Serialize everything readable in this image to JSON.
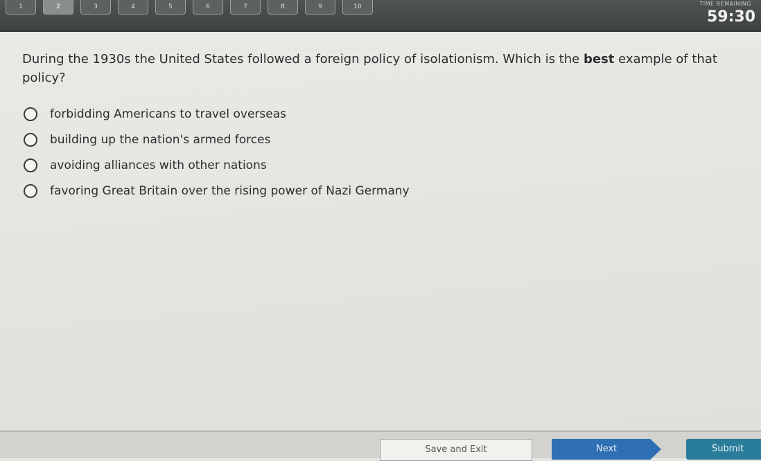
{
  "nav": {
    "questions": [
      "1",
      "2",
      "3",
      "4",
      "5",
      "6",
      "7",
      "8",
      "9",
      "10"
    ],
    "current_index": 1
  },
  "timer": {
    "label": "TIME REMAINING",
    "value": "59:30"
  },
  "question": {
    "text_before": "During the 1930s the United States followed a foreign policy of isolationism. Which is the ",
    "text_bold": "best",
    "text_after": " example of that policy?"
  },
  "choices": [
    {
      "label": "forbidding Americans to travel overseas"
    },
    {
      "label": "building up the nation's armed forces"
    },
    {
      "label": "avoiding alliances with other nations"
    },
    {
      "label": "favoring Great Britain over the rising power of Nazi Germany"
    }
  ],
  "footer": {
    "save_label": "Save and Exit",
    "next_label": "Next",
    "submit_label": "Submit"
  },
  "colors": {
    "next": "#2f6fb3",
    "submit": "#2a7d9a"
  }
}
